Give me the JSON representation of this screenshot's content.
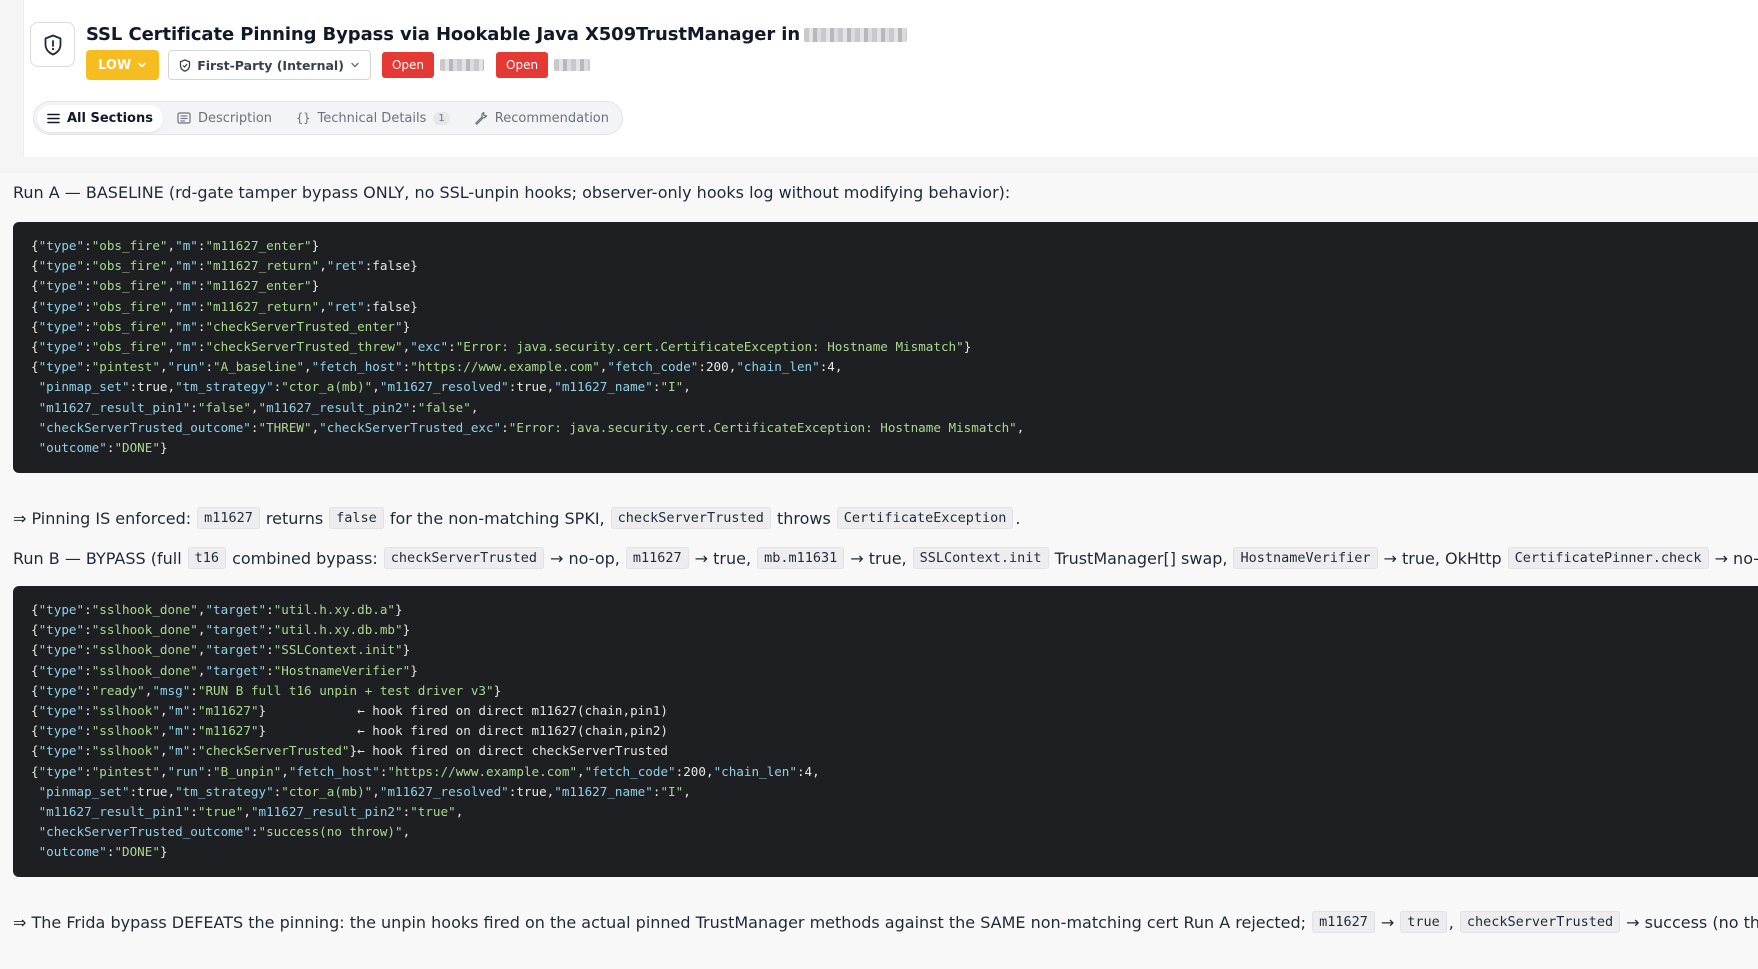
{
  "header": {
    "title": "SSL Certificate Pinning Bypass via Hookable Java X509TrustManager in",
    "severity": "LOW",
    "scope": "First-Party (Internal)",
    "statuses": [
      "Open",
      "Open"
    ]
  },
  "tabs": [
    {
      "label": "All Sections",
      "active": true,
      "icon": "list-icon"
    },
    {
      "label": "Description",
      "active": false,
      "icon": "document-icon"
    },
    {
      "label": "Technical Details",
      "active": false,
      "icon": "code-braces-icon",
      "count": "1"
    },
    {
      "label": "Recommendation",
      "active": false,
      "icon": "wrench-icon"
    }
  ],
  "run_a": {
    "heading": "Run A — BASELINE (rd-gate tamper bypass ONLY, no SSL-unpin hooks; observer-only hooks log without modifying behavior):",
    "code": [
      "{\"type\":\"obs_fire\",\"m\":\"m11627_enter\"}",
      "{\"type\":\"obs_fire\",\"m\":\"m11627_return\",\"ret\":false}",
      "{\"type\":\"obs_fire\",\"m\":\"m11627_enter\"}",
      "{\"type\":\"obs_fire\",\"m\":\"m11627_return\",\"ret\":false}",
      "{\"type\":\"obs_fire\",\"m\":\"checkServerTrusted_enter\"}",
      "{\"type\":\"obs_fire\",\"m\":\"checkServerTrusted_threw\",\"exc\":\"Error: java.security.cert.CertificateException: Hostname Mismatch\"}",
      "{\"type\":\"pintest\",\"run\":\"A_baseline\",\"fetch_host\":\"https://www.example.com\",\"fetch_code\":200,\"chain_len\":4,",
      " \"pinmap_set\":true,\"tm_strategy\":\"ctor_a(mb)\",\"m11627_resolved\":true,\"m11627_name\":\"I\",",
      " \"m11627_result_pin1\":\"false\",\"m11627_result_pin2\":\"false\",",
      " \"checkServerTrusted_outcome\":\"THREW\",\"checkServerTrusted_exc\":\"Error: java.security.cert.CertificateException: Hostname Mismatch\",",
      " \"outcome\":\"DONE\"}"
    ]
  },
  "enforced": {
    "t1": "⇒ Pinning IS enforced:",
    "c1": "m11627",
    "t2": "returns",
    "c2": "false",
    "t3": "for the non-matching SPKI,",
    "c3": "checkServerTrusted",
    "t4": "throws",
    "c4": "CertificateException",
    "t5": "."
  },
  "run_b_heading": {
    "t1": "Run B — BYPASS (full",
    "c1": "t16",
    "t2": "combined bypass:",
    "c2": "checkServerTrusted",
    "t3": "→ no-op,",
    "c3": "m11627",
    "t4": "→ true,",
    "c4": "mb.m11631",
    "t5": "→ true,",
    "c5": "SSLContext.init",
    "t6": "TrustManager[] swap,",
    "c6": "HostnameVerifier",
    "t7": "→ true, OkHttp",
    "c7": "CertificatePinner.check",
    "t8": "→ no-op):"
  },
  "run_b": {
    "code": [
      "{\"type\":\"sslhook_done\",\"target\":\"util.h.xy.db.a\"}",
      "{\"type\":\"sslhook_done\",\"target\":\"util.h.xy.db.mb\"}",
      "{\"type\":\"sslhook_done\",\"target\":\"SSLContext.init\"}",
      "{\"type\":\"sslhook_done\",\"target\":\"HostnameVerifier\"}",
      "{\"type\":\"ready\",\"msg\":\"RUN B full t16 unpin + test driver v3\"}",
      "{\"type\":\"sslhook\",\"m\":\"m11627\"}            ← hook fired on direct m11627(chain,pin1)",
      "{\"type\":\"sslhook\",\"m\":\"m11627\"}            ← hook fired on direct m11627(chain,pin2)",
      "{\"type\":\"sslhook\",\"m\":\"checkServerTrusted\"}← hook fired on direct checkServerTrusted",
      "{\"type\":\"pintest\",\"run\":\"B_unpin\",\"fetch_host\":\"https://www.example.com\",\"fetch_code\":200,\"chain_len\":4,",
      " \"pinmap_set\":true,\"tm_strategy\":\"ctor_a(mb)\",\"m11627_resolved\":true,\"m11627_name\":\"I\",",
      " \"m11627_result_pin1\":\"true\",\"m11627_result_pin2\":\"true\",",
      " \"checkServerTrusted_outcome\":\"success(no throw)\",",
      " \"outcome\":\"DONE\"}"
    ]
  },
  "conclusion": {
    "t1": "⇒ The Frida bypass DEFEATS the pinning: the unpin hooks fired on the actual pinned TrustManager methods against the SAME non-matching cert Run A rejected;",
    "c1": "m11627",
    "t2": "→",
    "c2": "true",
    "t3": ",",
    "c3": "checkServerTrusted",
    "t4": "→ success (no throw)."
  }
}
